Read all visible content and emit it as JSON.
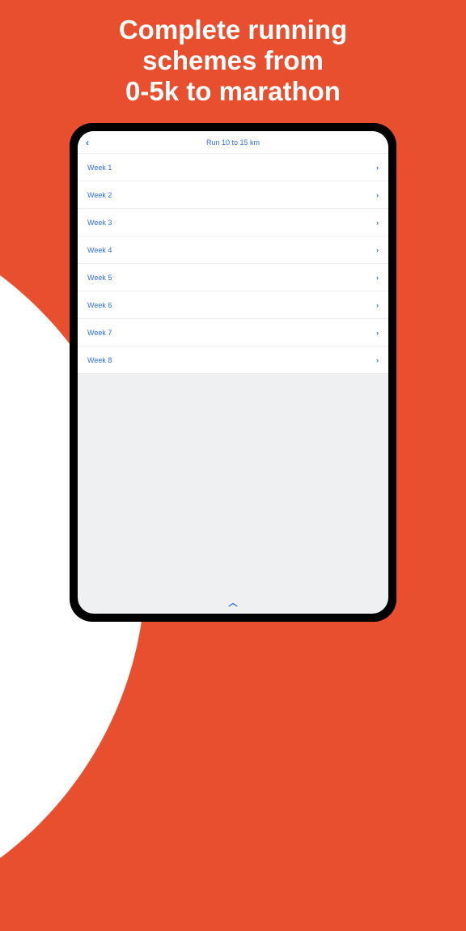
{
  "headline": {
    "line1": "Complete running",
    "line2": "schemes from",
    "line3": "0-5k to marathon"
  },
  "screen": {
    "title": "Run 10 to 15 km",
    "back_glyph": "‹",
    "chevron_glyph": "›",
    "handle_glyph": "︿",
    "weeks": [
      {
        "label": "Week 1"
      },
      {
        "label": "Week 2"
      },
      {
        "label": "Week 3"
      },
      {
        "label": "Week 4"
      },
      {
        "label": "Week 5"
      },
      {
        "label": "Week 6"
      },
      {
        "label": "Week 7"
      },
      {
        "label": "Week 8"
      }
    ]
  }
}
